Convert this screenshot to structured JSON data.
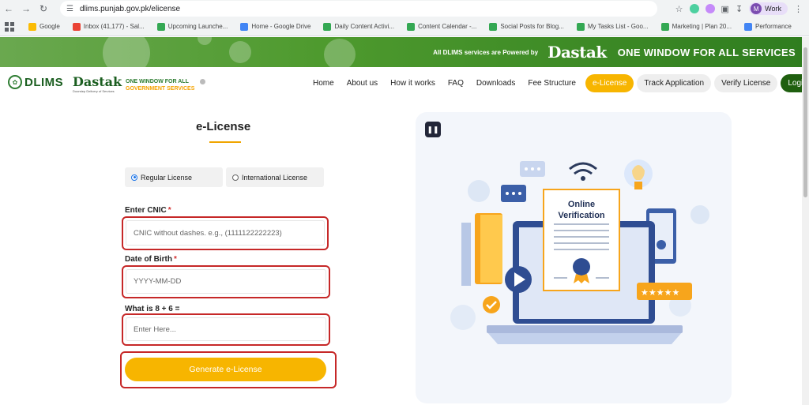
{
  "browser": {
    "url": "dlims.punjab.gov.pk/elicense",
    "profile_initial": "M",
    "profile_name": "Work",
    "bookmarks": [
      "Google",
      "Inbox (41,177) - Sal...",
      "Upcoming Launche...",
      "Home - Google Drive",
      "Daily Content Activi...",
      "Content Calendar -...",
      "Social Posts for Blog...",
      "My Tasks List - Goo...",
      "Marketing | Plan 20...",
      "Performance"
    ]
  },
  "banner": {
    "powered_text": "All DLIMS services are Powered by",
    "dastak_word": "Dastak",
    "tagline": "ONE WINDOW FOR ALL SERVICES"
  },
  "header": {
    "dlims_logo": "DLIMS",
    "dastak_logo": "Dastak",
    "dastak_sub": "Doorstep Delivery of Services",
    "one_window_line1": "ONE WINDOW FOR ALL",
    "one_window_line2": "GOVERNMENT SERVICES",
    "nav": [
      "Home",
      "About us",
      "How it works",
      "FAQ",
      "Downloads",
      "Fee Structure"
    ],
    "elicense_btn": "e-License",
    "track_btn": "Track Application",
    "verify_btn": "Verify License",
    "login_btn": "Login"
  },
  "form": {
    "title": "e-License",
    "license_types": [
      "Regular License",
      "International License"
    ],
    "selected_type": "Regular License",
    "cnic_label": "Enter CNIC",
    "cnic_placeholder": "CNIC without dashes. e.g., (1111122222223)",
    "dob_label": "Date of Birth",
    "dob_placeholder": "YYYY-MM-DD",
    "captcha_label": "What is 8 + 6 =",
    "captcha_placeholder": "Enter Here...",
    "required_mark": "*",
    "submit_label": "Generate e-License"
  },
  "illustration": {
    "certificate_line1": "Online",
    "certificate_line2": "Verification",
    "toggle_icon": "pause-icon"
  },
  "colors": {
    "brand_green": "#2e7d32",
    "accent_yellow": "#f7b500",
    "highlight_red": "#c62828"
  }
}
